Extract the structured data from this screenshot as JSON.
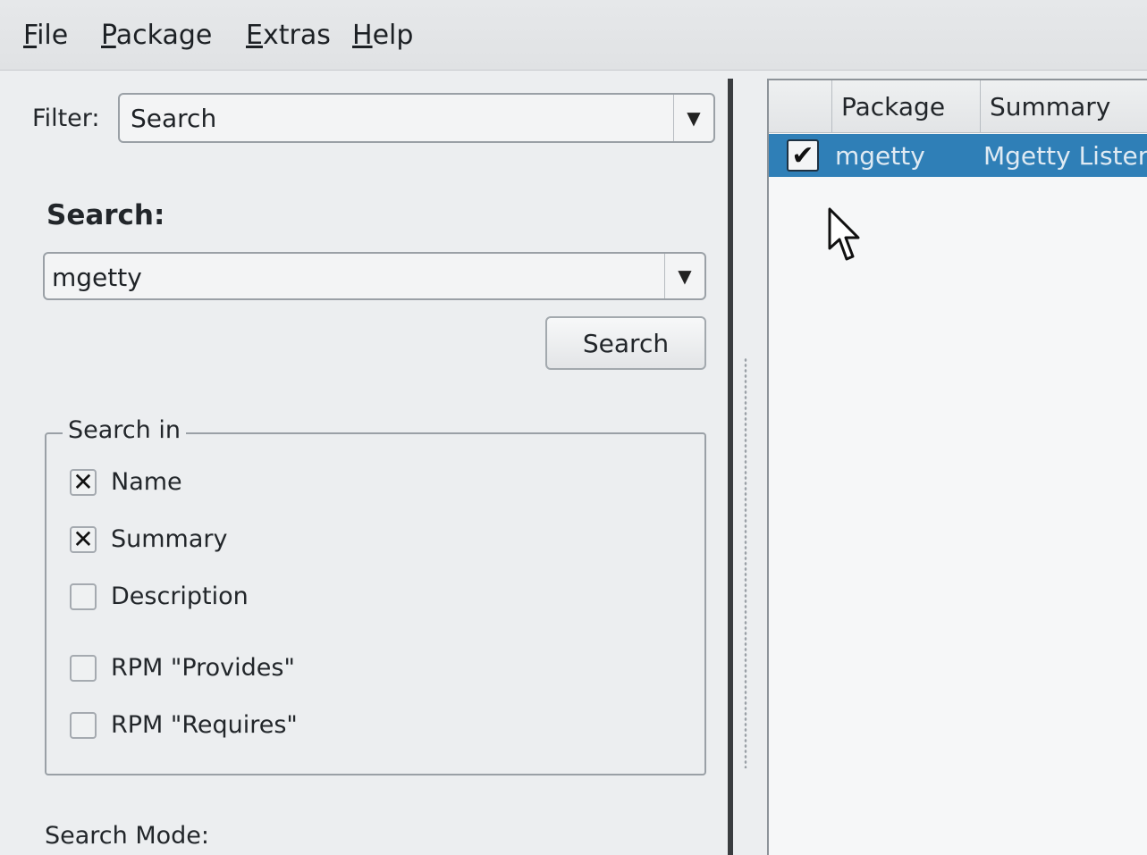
{
  "menu": {
    "file": {
      "u": "F",
      "rest": "ile"
    },
    "package": {
      "u": "P",
      "rest": "ackage"
    },
    "extras": {
      "u": "E",
      "rest": "xtras"
    },
    "help": {
      "u": "H",
      "rest": "elp"
    }
  },
  "filter": {
    "label": "Filter:",
    "value": "Search"
  },
  "search": {
    "heading": "Search:",
    "query": "mgetty",
    "button_label": "Search"
  },
  "search_in": {
    "legend": "Search in",
    "options": [
      {
        "label": "Name",
        "checked": true
      },
      {
        "label": "Summary",
        "checked": true
      },
      {
        "label": "Description",
        "checked": false
      },
      {
        "label": "RPM \"Provides\"",
        "checked": false
      },
      {
        "label": "RPM \"Requires\"",
        "checked": false
      }
    ]
  },
  "search_mode": {
    "label": "Search Mode:"
  },
  "results": {
    "columns": [
      "",
      "Package",
      "Summary"
    ],
    "rows": [
      {
        "checked": true,
        "package": "mgetty",
        "summary": "Mgetty Listen"
      }
    ]
  },
  "colors": {
    "selection": "#2f7fb7",
    "background": "#eceef0"
  },
  "icons": [
    "dropdown-arrow-icon",
    "mouse-pointer-icon",
    "checkmark-icon",
    "x-mark-icon"
  ]
}
